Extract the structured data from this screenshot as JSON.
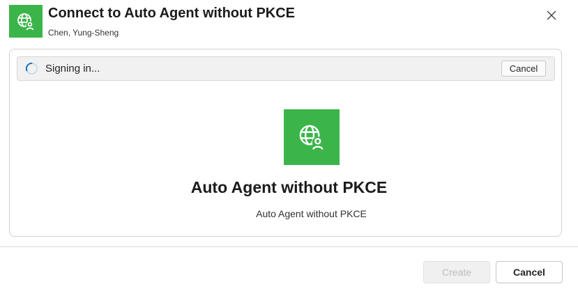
{
  "dialog": {
    "title": "Connect to Auto Agent without PKCE",
    "subtitle": "Chen, Yung-Sheng",
    "header_icon": "globe-person-icon",
    "close_icon": "close-icon"
  },
  "status_bar": {
    "text": "Signing in...",
    "cancel_label": "Cancel",
    "spinner_icon": "spinner-icon"
  },
  "agent": {
    "name": "Auto Agent without PKCE",
    "description": "Auto Agent without PKCE",
    "logo_icon": "globe-person-icon"
  },
  "footer": {
    "create_label": "Create",
    "cancel_label": "Cancel"
  },
  "colors": {
    "brand_green": "#3bb54a",
    "spinner_blue": "#0f6cbd"
  }
}
